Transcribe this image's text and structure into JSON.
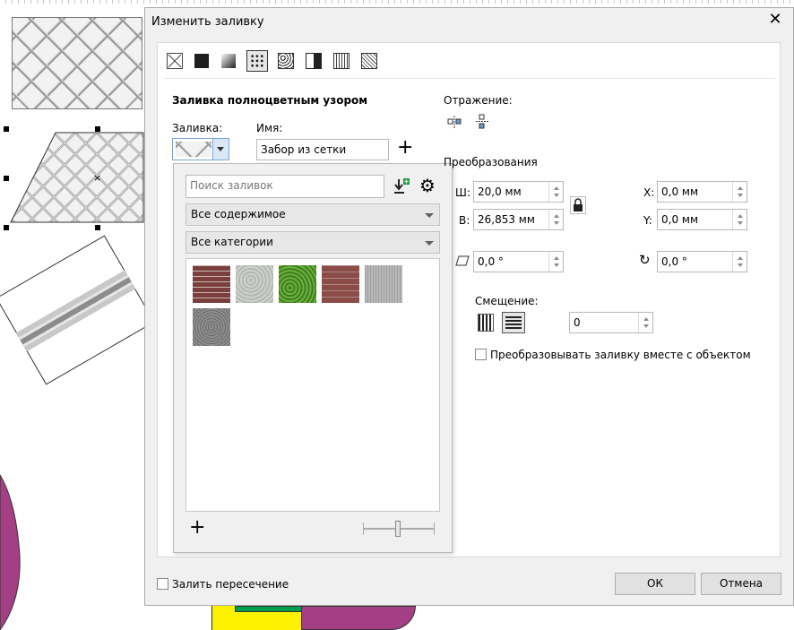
{
  "dialog": {
    "title": "Изменить заливку",
    "section_title": "Заливка полноцветным узором",
    "fill_label": "Заливка:",
    "name_label": "Имя:",
    "name_value": "Забор из сетки",
    "popup": {
      "search_placeholder": "Поиск заливок",
      "content_dropdown": "Все содержимое",
      "category_dropdown": "Все категории"
    },
    "reflection_label": "Отражение:",
    "transform_label": "Преобразования",
    "width_label": "Ш:",
    "width_value": "20,0 мм",
    "height_label": "В:",
    "height_value": "26,853 мм",
    "x_label": "X:",
    "x_value": "0,0 мм",
    "y_label": "Y:",
    "y_value": "0,0 мм",
    "skew_value": "0,0 °",
    "rotate_value": "0,0 °",
    "offset_label": "Смещение:",
    "offset_value": "0",
    "transform_with_object_label": "Преобразовывать заливку вместе с объектом",
    "fill_intersection_label": "Залить пересечение",
    "ok_label": "ОК",
    "cancel_label": "Отмена"
  },
  "colors": {
    "magenta": "#a43f86",
    "yellow": "#fff200",
    "green": "#009f4d",
    "brick": "#8b4c48",
    "grass": "#4a8f2a"
  }
}
